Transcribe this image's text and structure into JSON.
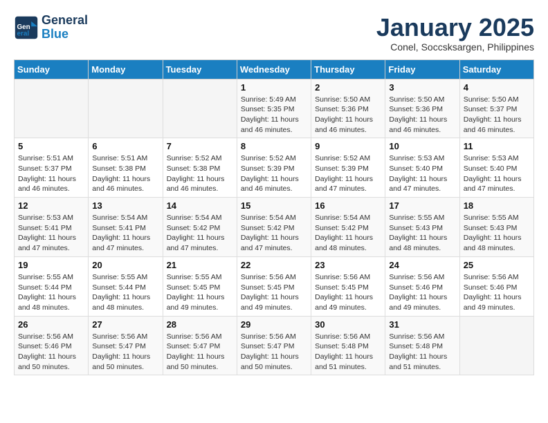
{
  "header": {
    "logo_line1": "General",
    "logo_line2": "Blue",
    "month": "January 2025",
    "location": "Conel, Soccsksargen, Philippines"
  },
  "days_of_week": [
    "Sunday",
    "Monday",
    "Tuesday",
    "Wednesday",
    "Thursday",
    "Friday",
    "Saturday"
  ],
  "weeks": [
    [
      {
        "day": "",
        "info": ""
      },
      {
        "day": "",
        "info": ""
      },
      {
        "day": "",
        "info": ""
      },
      {
        "day": "1",
        "info": "Sunrise: 5:49 AM\nSunset: 5:35 PM\nDaylight: 11 hours and 46 minutes."
      },
      {
        "day": "2",
        "info": "Sunrise: 5:50 AM\nSunset: 5:36 PM\nDaylight: 11 hours and 46 minutes."
      },
      {
        "day": "3",
        "info": "Sunrise: 5:50 AM\nSunset: 5:36 PM\nDaylight: 11 hours and 46 minutes."
      },
      {
        "day": "4",
        "info": "Sunrise: 5:50 AM\nSunset: 5:37 PM\nDaylight: 11 hours and 46 minutes."
      }
    ],
    [
      {
        "day": "5",
        "info": "Sunrise: 5:51 AM\nSunset: 5:37 PM\nDaylight: 11 hours and 46 minutes."
      },
      {
        "day": "6",
        "info": "Sunrise: 5:51 AM\nSunset: 5:38 PM\nDaylight: 11 hours and 46 minutes."
      },
      {
        "day": "7",
        "info": "Sunrise: 5:52 AM\nSunset: 5:38 PM\nDaylight: 11 hours and 46 minutes."
      },
      {
        "day": "8",
        "info": "Sunrise: 5:52 AM\nSunset: 5:39 PM\nDaylight: 11 hours and 46 minutes."
      },
      {
        "day": "9",
        "info": "Sunrise: 5:52 AM\nSunset: 5:39 PM\nDaylight: 11 hours and 47 minutes."
      },
      {
        "day": "10",
        "info": "Sunrise: 5:53 AM\nSunset: 5:40 PM\nDaylight: 11 hours and 47 minutes."
      },
      {
        "day": "11",
        "info": "Sunrise: 5:53 AM\nSunset: 5:40 PM\nDaylight: 11 hours and 47 minutes."
      }
    ],
    [
      {
        "day": "12",
        "info": "Sunrise: 5:53 AM\nSunset: 5:41 PM\nDaylight: 11 hours and 47 minutes."
      },
      {
        "day": "13",
        "info": "Sunrise: 5:54 AM\nSunset: 5:41 PM\nDaylight: 11 hours and 47 minutes."
      },
      {
        "day": "14",
        "info": "Sunrise: 5:54 AM\nSunset: 5:42 PM\nDaylight: 11 hours and 47 minutes."
      },
      {
        "day": "15",
        "info": "Sunrise: 5:54 AM\nSunset: 5:42 PM\nDaylight: 11 hours and 47 minutes."
      },
      {
        "day": "16",
        "info": "Sunrise: 5:54 AM\nSunset: 5:42 PM\nDaylight: 11 hours and 48 minutes."
      },
      {
        "day": "17",
        "info": "Sunrise: 5:55 AM\nSunset: 5:43 PM\nDaylight: 11 hours and 48 minutes."
      },
      {
        "day": "18",
        "info": "Sunrise: 5:55 AM\nSunset: 5:43 PM\nDaylight: 11 hours and 48 minutes."
      }
    ],
    [
      {
        "day": "19",
        "info": "Sunrise: 5:55 AM\nSunset: 5:44 PM\nDaylight: 11 hours and 48 minutes."
      },
      {
        "day": "20",
        "info": "Sunrise: 5:55 AM\nSunset: 5:44 PM\nDaylight: 11 hours and 48 minutes."
      },
      {
        "day": "21",
        "info": "Sunrise: 5:55 AM\nSunset: 5:45 PM\nDaylight: 11 hours and 49 minutes."
      },
      {
        "day": "22",
        "info": "Sunrise: 5:56 AM\nSunset: 5:45 PM\nDaylight: 11 hours and 49 minutes."
      },
      {
        "day": "23",
        "info": "Sunrise: 5:56 AM\nSunset: 5:45 PM\nDaylight: 11 hours and 49 minutes."
      },
      {
        "day": "24",
        "info": "Sunrise: 5:56 AM\nSunset: 5:46 PM\nDaylight: 11 hours and 49 minutes."
      },
      {
        "day": "25",
        "info": "Sunrise: 5:56 AM\nSunset: 5:46 PM\nDaylight: 11 hours and 49 minutes."
      }
    ],
    [
      {
        "day": "26",
        "info": "Sunrise: 5:56 AM\nSunset: 5:46 PM\nDaylight: 11 hours and 50 minutes."
      },
      {
        "day": "27",
        "info": "Sunrise: 5:56 AM\nSunset: 5:47 PM\nDaylight: 11 hours and 50 minutes."
      },
      {
        "day": "28",
        "info": "Sunrise: 5:56 AM\nSunset: 5:47 PM\nDaylight: 11 hours and 50 minutes."
      },
      {
        "day": "29",
        "info": "Sunrise: 5:56 AM\nSunset: 5:47 PM\nDaylight: 11 hours and 50 minutes."
      },
      {
        "day": "30",
        "info": "Sunrise: 5:56 AM\nSunset: 5:48 PM\nDaylight: 11 hours and 51 minutes."
      },
      {
        "day": "31",
        "info": "Sunrise: 5:56 AM\nSunset: 5:48 PM\nDaylight: 11 hours and 51 minutes."
      },
      {
        "day": "",
        "info": ""
      }
    ]
  ]
}
